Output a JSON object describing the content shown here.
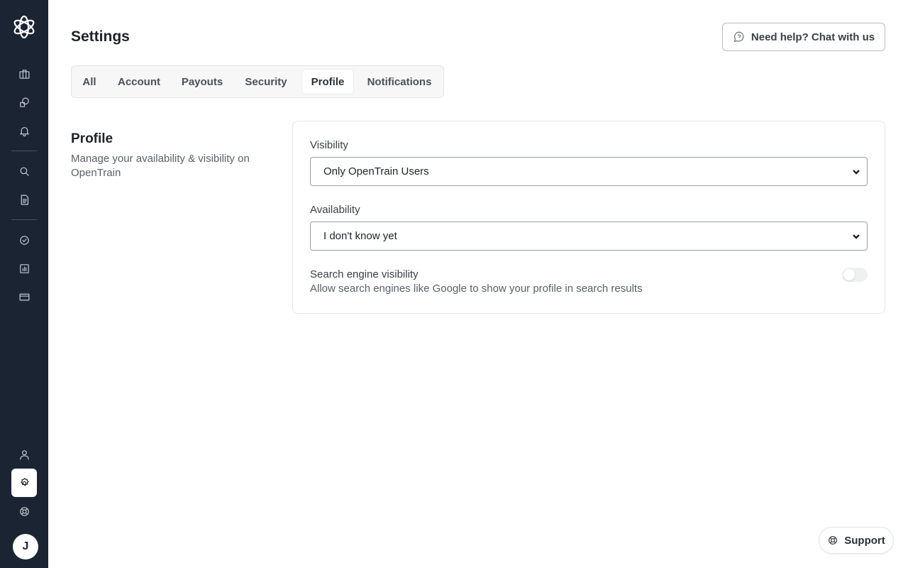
{
  "page": {
    "title": "Settings"
  },
  "header": {
    "help_label": "Need help? Chat with us",
    "help_icon": "question-chat-icon"
  },
  "sidebar": {
    "logo": "opentrain-logo",
    "avatar_initial": "J",
    "items": [
      {
        "icon": "briefcase-icon"
      },
      {
        "icon": "shapes-icon"
      },
      {
        "icon": "bell-icon"
      },
      {
        "icon": "search-icon"
      },
      {
        "icon": "document-icon"
      },
      {
        "icon": "check-circle-icon"
      },
      {
        "icon": "chart-icon"
      },
      {
        "icon": "credit-card-icon"
      },
      {
        "icon": "user-icon"
      },
      {
        "icon": "gear-icon",
        "active": true
      },
      {
        "icon": "lifebuoy-icon"
      }
    ]
  },
  "tabs": [
    {
      "label": "All"
    },
    {
      "label": "Account"
    },
    {
      "label": "Payouts"
    },
    {
      "label": "Security"
    },
    {
      "label": "Profile",
      "active": true
    },
    {
      "label": "Notifications"
    }
  ],
  "section": {
    "title": "Profile",
    "description": "Manage your availability & visibility on OpenTrain"
  },
  "form": {
    "visibility_label": "Visibility",
    "visibility_value": "Only OpenTrain Users",
    "availability_label": "Availability",
    "availability_value": "I don't know yet",
    "search_visibility_title": "Search engine visibility",
    "search_visibility_desc": "Allow search engines like Google to show your profile in search results",
    "search_visibility_enabled": false
  },
  "support": {
    "label": "Support",
    "icon": "lifebuoy-icon"
  },
  "colors": {
    "sidebar_bg": "#1b2433",
    "accent": "#1b2433"
  }
}
